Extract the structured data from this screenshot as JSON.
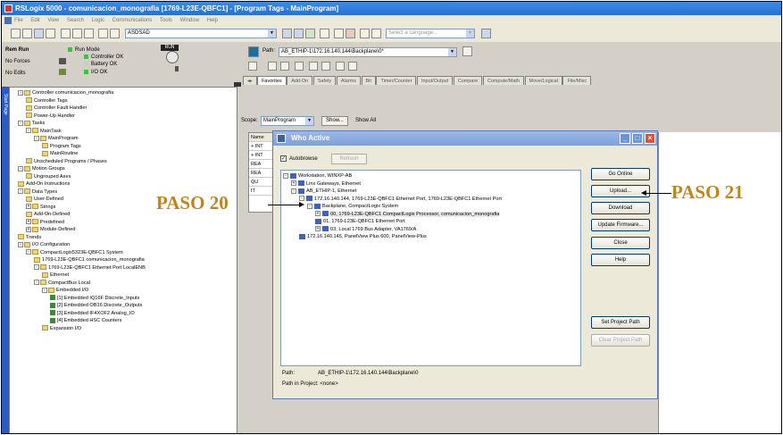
{
  "window": {
    "title": "RSLogix 5000 - comunicacion_monografia [1769-L23E-QBFC1] - [Program Tags - MainProgram]",
    "menu": [
      "File",
      "Edit",
      "View",
      "Search",
      "Logic",
      "Communications",
      "Tools",
      "Window",
      "Help"
    ]
  },
  "toolbar": {
    "search_value": "ASDSAD",
    "language_placeholder": "Select a Language..."
  },
  "status": {
    "mode": "Rem Run",
    "forces": "No Forces",
    "edits": "No Edits",
    "run_mode": "Run Mode",
    "controller_ok": "Controller OK",
    "battery_ok": "Battery OK",
    "io_ok": "I/O OK",
    "key_label": "RUN"
  },
  "path": {
    "label": "Path:",
    "value": "AB_ETHIP-1\\172.16.140.144\\Backplane\\0*"
  },
  "tabs": [
    "Favorites",
    "Add-On",
    "Safety",
    "Alarms",
    "Bit",
    "Timer/Counter",
    "Input/Output",
    "Compare",
    "Compute/Math",
    "Move/Logical",
    "File/Misc"
  ],
  "sidebar_strip_label": "Start Page",
  "tree": [
    {
      "label": "Controller comunicacion_monografia",
      "indent": 1,
      "pm": "-"
    },
    {
      "label": "Controller Tags",
      "indent": 2,
      "pm": ""
    },
    {
      "label": "Controller Fault Handler",
      "indent": 2,
      "pm": ""
    },
    {
      "label": "Power-Up Handler",
      "indent": 2,
      "pm": ""
    },
    {
      "label": "Tasks",
      "indent": 1,
      "pm": "-"
    },
    {
      "label": "MainTask",
      "indent": 2,
      "pm": "-"
    },
    {
      "label": "MainProgram",
      "indent": 3,
      "pm": "-"
    },
    {
      "label": "Program Tags",
      "indent": 4,
      "pm": ""
    },
    {
      "label": "MainRoutine",
      "indent": 4,
      "pm": ""
    },
    {
      "label": "Unscheduled Programs / Phases",
      "indent": 2,
      "pm": ""
    },
    {
      "label": "Motion Groups",
      "indent": 1,
      "pm": "-"
    },
    {
      "label": "Ungrouped Axes",
      "indent": 2,
      "pm": ""
    },
    {
      "label": "Add-On Instructions",
      "indent": 1,
      "pm": ""
    },
    {
      "label": "Data Types",
      "indent": 1,
      "pm": "-"
    },
    {
      "label": "User-Defined",
      "indent": 2,
      "pm": ""
    },
    {
      "label": "Strings",
      "indent": 2,
      "pm": "+"
    },
    {
      "label": "Add-On-Defined",
      "indent": 2,
      "pm": ""
    },
    {
      "label": "Predefined",
      "indent": 2,
      "pm": "+"
    },
    {
      "label": "Module-Defined",
      "indent": 2,
      "pm": "+"
    },
    {
      "label": "Trends",
      "indent": 1,
      "pm": ""
    },
    {
      "label": "I/O Configuration",
      "indent": 1,
      "pm": "-"
    },
    {
      "label": "CompactLogix5323E-QBFC1 System",
      "indent": 2,
      "pm": "-"
    },
    {
      "label": "1769-L23E-QBFC1 comunicacion_monografia",
      "indent": 3,
      "pm": ""
    },
    {
      "label": "1769-L23E-QBFC1 Ethernet Port LocalENB",
      "indent": 3,
      "pm": "-"
    },
    {
      "label": "Ethernet",
      "indent": 4,
      "pm": ""
    },
    {
      "label": "CompactBus Local",
      "indent": 3,
      "pm": "-"
    },
    {
      "label": "Embedded I/O",
      "indent": 4,
      "pm": "-"
    },
    {
      "label": "[1] Embedded IQ16F Discrete_Inputs",
      "indent": 5,
      "pm": ""
    },
    {
      "label": "[2] Embedded OB16 Discrete_Outputs",
      "indent": 5,
      "pm": ""
    },
    {
      "label": "[3] Embedded IF4XOF2 Analog_IO",
      "indent": 5,
      "pm": ""
    },
    {
      "label": "[4] Embedded HSC Counters",
      "indent": 5,
      "pm": ""
    },
    {
      "label": "Expansion I/O",
      "indent": 4,
      "pm": ""
    }
  ],
  "scope": {
    "label": "Scope:",
    "value": "MainProgram",
    "show_label": "Show...",
    "show_value": "Show All"
  },
  "grid": {
    "header": "Name",
    "rows": [
      "+ INT",
      "+ INT",
      "REA",
      "REA",
      "QU",
      "IT"
    ]
  },
  "dialog": {
    "title": "Who Active",
    "autobrowse_label": "Autobrowse",
    "autobrowse_checked": "✓",
    "refresh_label": "Refresh",
    "tree": [
      {
        "label": "Workstation, WINXP-AB",
        "indent": 0,
        "pm": "-"
      },
      {
        "label": "Linx Gateways, Ethernet",
        "indent": 1,
        "pm": "+"
      },
      {
        "label": "AB_ETHIP-1, Ethernet",
        "indent": 1,
        "pm": "-"
      },
      {
        "label": "172.16.140.144, 1769-L23E-QBFC1 Ethernet Port, 1769-L23E-QBFC1 Ethernet Port",
        "indent": 2,
        "pm": "-"
      },
      {
        "label": "Backplane, CompactLogix System",
        "indent": 3,
        "pm": "-"
      },
      {
        "label": "00, 1769-L23E-QBFC1 CompactLogix Processor, comunicacion_monografia",
        "indent": 4,
        "pm": "+",
        "selected": true
      },
      {
        "label": "01, 1769-L23E-QBFC1 Ethernet Port",
        "indent": 4,
        "pm": ""
      },
      {
        "label": "03, Local 1769 Bus Adapter, VA1769/A",
        "indent": 4,
        "pm": "+"
      },
      {
        "label": "172.16.140.145, PanelView Plus 600, PanelView-Plus",
        "indent": 2,
        "pm": ""
      }
    ],
    "buttons": {
      "go_online": "Go Online",
      "upload": "Upload...",
      "download": "Download",
      "update_firmware": "Update Firmware...",
      "close": "Close",
      "help": "Help",
      "set_project_path": "Set Project Path",
      "clear_project_path": "Clear Project Path"
    },
    "path_label": "Path:",
    "path_value": "AB_ETHIP-1\\172.16.140.144\\Backplane\\0",
    "path_in_project_label": "Path in Project:",
    "path_in_project_value": "<none>"
  },
  "annotations": {
    "paso20": "PASO 20",
    "paso21": "PASO 21",
    "color": "#c0841a"
  }
}
